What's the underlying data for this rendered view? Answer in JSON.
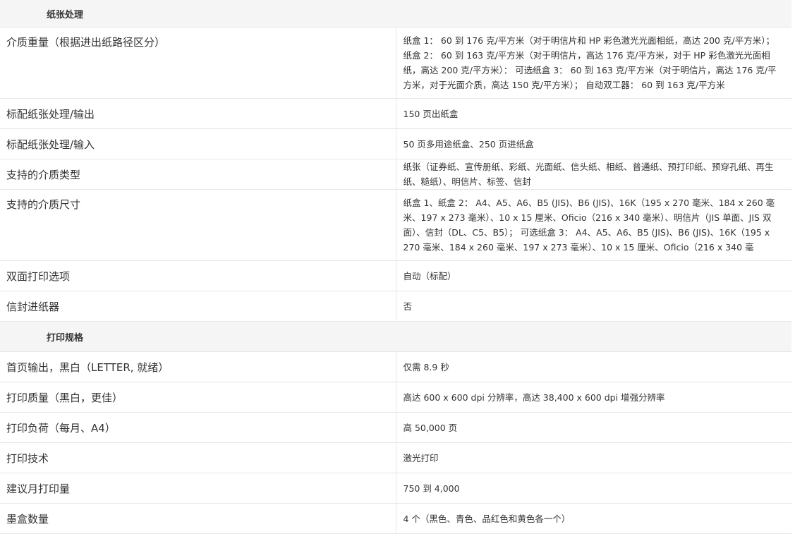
{
  "sections": [
    {
      "title": "纸张处理",
      "rows": [
        {
          "label": "介质重量（根据进出纸路径区分）",
          "value": "纸盒 1： 60 到 176 克/平方米（对于明信片和 HP 彩色激光光面相纸，高达 200 克/平方米）； 纸盒 2： 60 到 163 克/平方米（对于明信片，高达 176 克/平方米，对于 HP 彩色激光光面相纸，高达 200 克/平方米）： 可选纸盒 3： 60 到 163 克/平方米（对于明信片，高达 176 克/平方米，对于光面介质，高达 150 克/平方米）； 自动双工器： 60 到 163 克/平方米"
        },
        {
          "label": "标配纸张处理/输出",
          "value": "150 页出纸盒"
        },
        {
          "label": "标配纸张处理/输入",
          "value": "50 页多用途纸盒、250 页进纸盒"
        },
        {
          "label": "支持的介质类型",
          "value": "纸张（证券纸、宣传册纸、彩纸、光面纸、信头纸、相纸、普通纸、预打印纸、预穿孔纸、再生纸、糙纸）、明信片、标签、信封"
        },
        {
          "label": "支持的介质尺寸",
          "value": "纸盒 1、纸盒 2： A4、A5、A6、B5 (JIS)、B6 (JIS)、16K（195 x 270 毫米、184 x 260 毫米、197 x 273 毫米）、10 x 15 厘米、Oficio（216 x 340 毫米）、明信片（JIS 单面、JIS 双面）、信封（DL、C5、B5）； 可选纸盒 3： A4、A5、A6、B5 (JIS)、B6 (JIS)、16K（195 x 270 毫米、184 x 260 毫米、197 x 273 毫米）、10 x 15 厘米、Oficio（216 x 340 毫"
        },
        {
          "label": "双面打印选项",
          "value": "自动（标配）"
        },
        {
          "label": "信封进纸器",
          "value": "否"
        }
      ]
    },
    {
      "title": "打印规格",
      "rows": [
        {
          "label": "首页输出，黑白（LETTER, 就绪）",
          "value": "仅需 8.9 秒"
        },
        {
          "label": "打印质量（黑白，更佳）",
          "value": "高达 600 x 600 dpi 分辨率，高达 38,400 x 600 dpi 增强分辨率"
        },
        {
          "label": "打印负荷（每月、A4）",
          "value": "高 50,000 页"
        },
        {
          "label": "打印技术",
          "value": "激光打印"
        },
        {
          "label": "建议月打印量",
          "value": "750 到 4,000"
        },
        {
          "label": "墨盒数量",
          "value": "4 个（黑色、青色、品红色和黄色各一个）"
        }
      ]
    }
  ]
}
